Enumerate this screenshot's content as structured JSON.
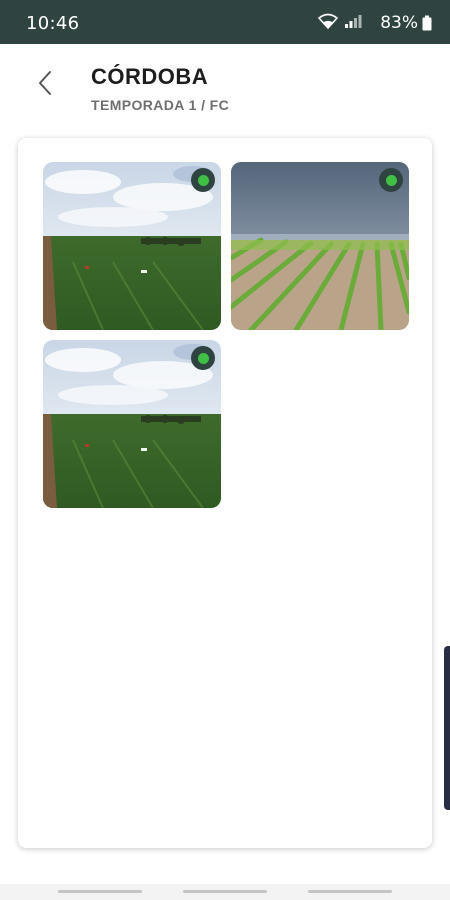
{
  "status_bar": {
    "time": "10:46",
    "battery": "83%",
    "background": "#2f4440"
  },
  "header": {
    "title": "CÓRDOBA",
    "subtitle": "TEMPORADA 1 / FC",
    "back_icon": "chevron-left-icon"
  },
  "gallery": {
    "photos": [
      {
        "scene": "potato-field-cloudy-sky",
        "status_color": "#3fbf44"
      },
      {
        "scene": "crop-rows-stormy-sky",
        "status_color": "#3fbf44"
      },
      {
        "scene": "potato-field-cloudy-sky",
        "status_color": "#3fbf44"
      }
    ]
  },
  "colors": {
    "accent": "#2f4440",
    "status_ok": "#3fbf44"
  }
}
